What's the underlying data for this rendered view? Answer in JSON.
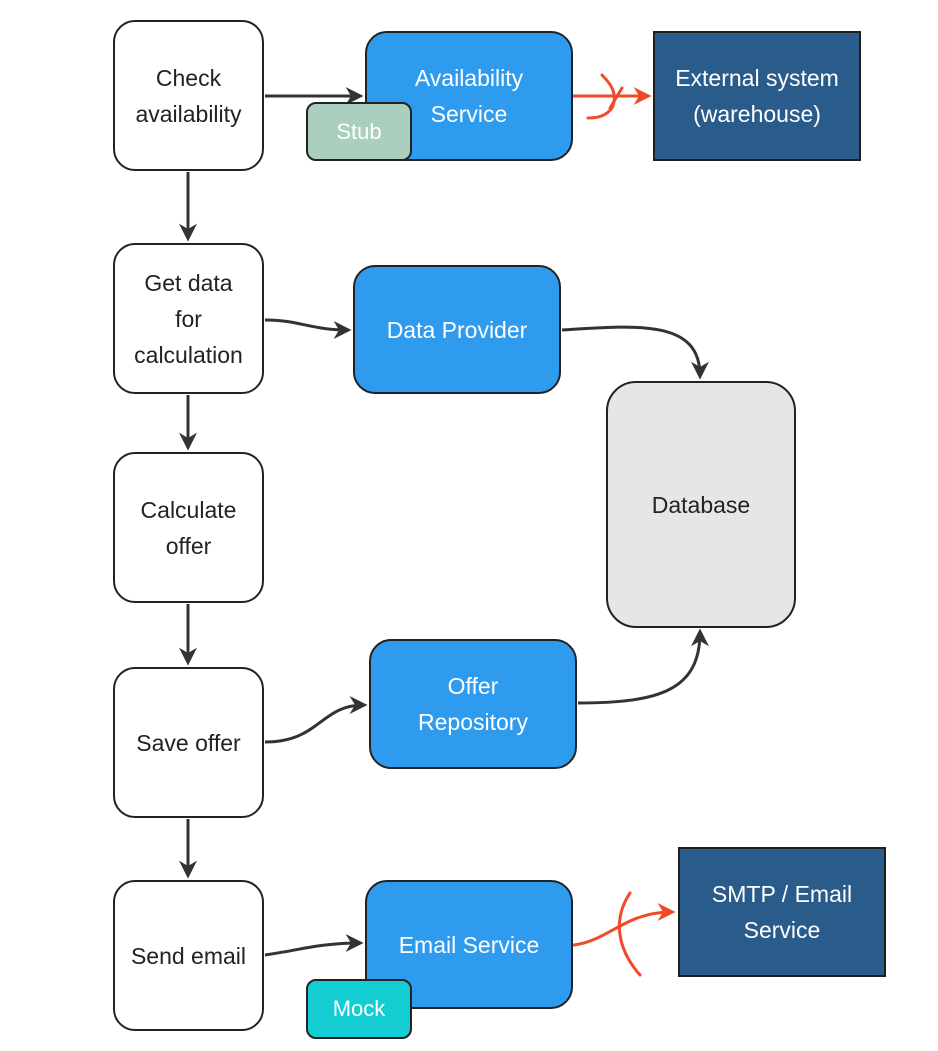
{
  "colors": {
    "service": "#2f9bef",
    "external": "#295c8a",
    "database": "#e6e6e6",
    "stub": "#abcfbe",
    "mock": "#14cdd3",
    "arrow": "#333333",
    "broken_arrow": "#f04a2a"
  },
  "steps": [
    {
      "label": "Check\navailability"
    },
    {
      "label": "Get data\nfor\ncalculation"
    },
    {
      "label": "Calculate\noffer"
    },
    {
      "label": "Save offer"
    },
    {
      "label": "Send email"
    }
  ],
  "services": {
    "availability": "Availability\nService",
    "data_provider": "Data Provider",
    "offer_repository": "Offer\nRepository",
    "email": "Email Service"
  },
  "externals": {
    "warehouse": "External system\n(warehouse)",
    "smtp": "SMTP / Email\nService"
  },
  "database": "Database",
  "tags": {
    "stub": "Stub",
    "mock": "Mock"
  }
}
